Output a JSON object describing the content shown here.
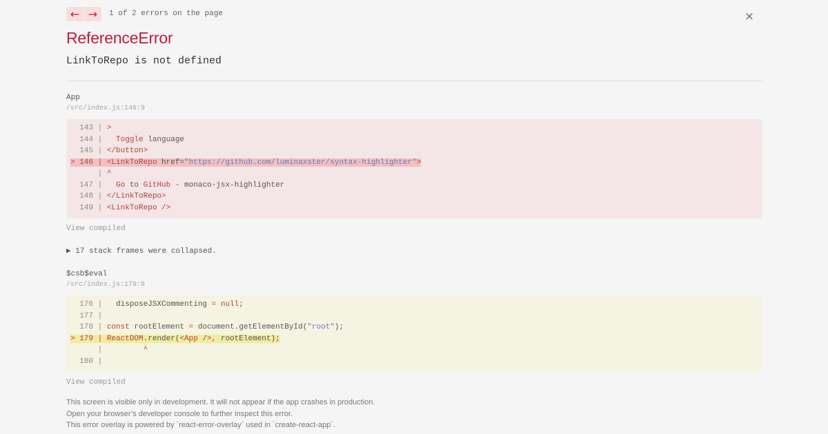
{
  "nav": {
    "prev_label": "←",
    "next_label": "→",
    "count_text": "1 of 2 errors on the page"
  },
  "close_label": "×",
  "error": {
    "type": "ReferenceError",
    "message": "LinkToRepo is not defined"
  },
  "frames": [
    {
      "name": "App",
      "path": "/src/index.js:146:9",
      "view_compiled": "View compiled",
      "lines": [
        {
          "gutter": "  143 | ",
          "parts": [
            {
              "t": ">",
              "c": "tag"
            }
          ]
        },
        {
          "gutter": "  144 | ",
          "parts": [
            {
              "t": "  Toggle",
              "c": "tag"
            },
            {
              "t": " language",
              "c": "txt"
            }
          ]
        },
        {
          "gutter": "  145 | ",
          "parts": [
            {
              "t": "</button>",
              "c": "tag"
            }
          ]
        },
        {
          "gutter": "> 146 | ",
          "highlight": true,
          "parts": [
            {
              "t": "<LinkToRepo",
              "c": "tag"
            },
            {
              "t": " href=",
              "c": "attr"
            },
            {
              "t": "\"https://github.com/luminaxster/syntax-highlighter\"",
              "c": "str"
            },
            {
              "t": ">",
              "c": "tag"
            }
          ]
        },
        {
          "gutter": "      | ",
          "parts": [
            {
              "t": "^",
              "c": "caret"
            }
          ]
        },
        {
          "gutter": "  147 | ",
          "parts": [
            {
              "t": "  Go",
              "c": "tag"
            },
            {
              "t": " to ",
              "c": "txt"
            },
            {
              "t": "GitHub",
              "c": "tag"
            },
            {
              "t": " - ",
              "c": "txt"
            },
            {
              "t": "monaco-jsx-highlighter",
              "c": "txt"
            }
          ]
        },
        {
          "gutter": "  148 | ",
          "parts": [
            {
              "t": "</LinkToRepo>",
              "c": "tag"
            }
          ]
        },
        {
          "gutter": "  149 | ",
          "parts": [
            {
              "t": "<LinkToRepo />",
              "c": "tag"
            }
          ]
        }
      ]
    },
    {
      "name": "$csb$eval",
      "path": "/src/index.js:179:9",
      "view_compiled": "View compiled",
      "lines": [
        {
          "gutter": "  176 | ",
          "parts": [
            {
              "t": "  disposeJSXCommenting ",
              "c": "txt"
            },
            {
              "t": "=",
              "c": "kw"
            },
            {
              "t": " ",
              "c": "txt"
            },
            {
              "t": "null",
              "c": "kw"
            },
            {
              "t": ";",
              "c": "txt"
            }
          ]
        },
        {
          "gutter": "  177 | ",
          "parts": []
        },
        {
          "gutter": "  178 | ",
          "parts": [
            {
              "t": "const",
              "c": "kw"
            },
            {
              "t": " rootElement ",
              "c": "txt"
            },
            {
              "t": "=",
              "c": "kw"
            },
            {
              "t": " document.getElementById(",
              "c": "txt"
            },
            {
              "t": "\"root\"",
              "c": "str"
            },
            {
              "t": ");",
              "c": "txt"
            }
          ]
        },
        {
          "gutter": "> 179 | ",
          "highlight": true,
          "parts": [
            {
              "t": "ReactDOM",
              "c": "tag"
            },
            {
              "t": ".render(",
              "c": "txt"
            },
            {
              "t": "<App />",
              "c": "tag"
            },
            {
              "t": ", rootElement);",
              "c": "txt"
            }
          ]
        },
        {
          "gutter": "      | ",
          "parts": [
            {
              "t": "        ^",
              "c": "caret"
            }
          ]
        },
        {
          "gutter": "  180 | ",
          "parts": []
        }
      ]
    }
  ],
  "collapsed_text": "▶ 17 stack frames were collapsed.",
  "footer": [
    "This screen is visible only in development. It will not appear if the app crashes in production.",
    "Open your browser’s developer console to further inspect this error.",
    "This error overlay is powered by `react-error-overlay` used in `create-react-app`."
  ],
  "colors": {
    "error_red": "#c41a3a",
    "frame1_bg": "#f4e6e6",
    "frame2_bg": "#f5f3e1"
  }
}
